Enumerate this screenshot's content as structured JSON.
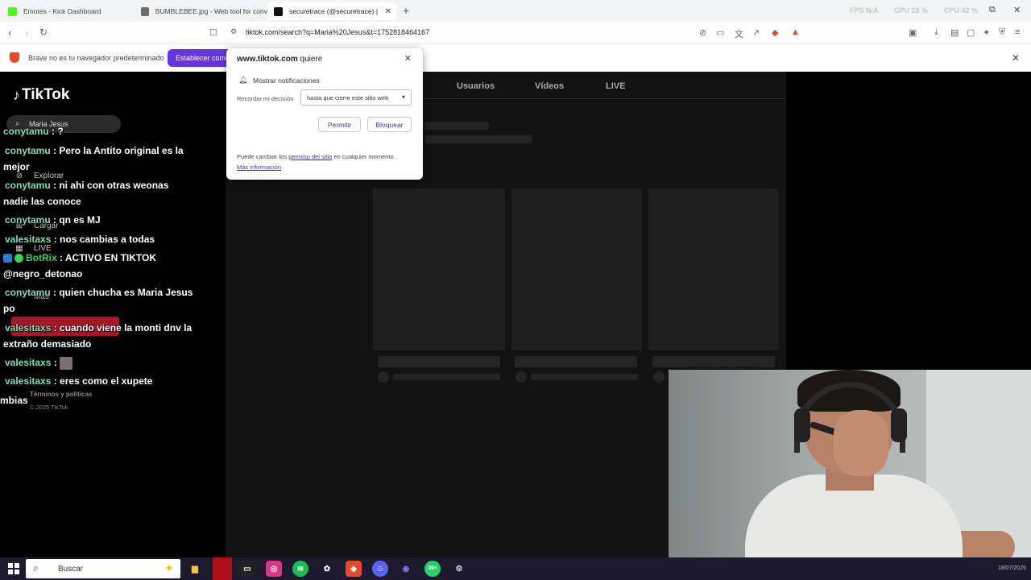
{
  "browser": {
    "tabs": [
      {
        "title": "Emotes - Kick Dashboard",
        "color": "#53fc18"
      },
      {
        "title": "BUMBLEBEE.jpg - Web tool for conv",
        "color": "#6b6b6b"
      },
      {
        "title": "securetrace (@securetrace) | TikT",
        "color": "#111111"
      }
    ],
    "close_glyph": "✕",
    "new_tab_glyph": "+",
    "sys_stats": [
      "FPS N/A",
      "CPU 28 %",
      "CPU 42 %"
    ],
    "window_controls": [
      "⎯",
      "⧉",
      "✕"
    ],
    "url": "tiktok.com/search?q=Maria%20Jesus&t=1752818464167",
    "nav_icons": [
      "chevron-left-icon",
      "chevron-right-icon",
      "reload-icon"
    ],
    "info_bar": {
      "message": "Brave no es tu navegador predeterminado",
      "button": "Establecer como"
    }
  },
  "tiktok": {
    "logo": "TikTok",
    "search_value": "Maria Jesus",
    "tabs": [
      "Usuarios",
      "Vídeos",
      "LIVE"
    ],
    "sidebar": [
      {
        "label": "Explorar",
        "icon": "⊘"
      },
      {
        "label": "Cargar",
        "icon": "⊞"
      },
      {
        "label": "LIVE",
        "icon": "▦"
      },
      {
        "label": "Más",
        "icon": "⋯"
      }
    ],
    "footer": {
      "terms": "Términos y políticas",
      "copyright": "© 2025 TikTok"
    }
  },
  "popup": {
    "site": "www.tiktok.com",
    "wants": " quiere",
    "permission": "Mostrar notificaciones",
    "remember_label": "Recordar mi decisión",
    "remember_value": "hasta que cierre este sitio web",
    "allow": "Permitir",
    "block": "Bloquear",
    "footer_pre": "Puede cambiar los ",
    "footer_link": "permiso del sitio",
    "footer_post": " en cualquier momento.",
    "more_info": "Más información"
  },
  "chat": [
    {
      "user": "conytamu",
      "text": " : ?"
    },
    {
      "user": "conytamu",
      "text": " : Pero la Antito original es la mejor"
    },
    {
      "user": "conytamu",
      "text": " : ni ahi con otras weonas nadie las conoce"
    },
    {
      "user": "conytamu",
      "text": " : qn es MJ"
    },
    {
      "user": "valesitaxs",
      "text": " : nos cambias a todas"
    },
    {
      "user": "BotRix",
      "text": " : ACTIVO EN TIKTOK @negro_detonao"
    },
    {
      "user": "conytamu",
      "text": " : quien chucha es Maria Jesus po"
    },
    {
      "user": "valesitaxs",
      "text": " : cuando viene la monti dnv la extraño demasiado"
    },
    {
      "user": "valesitaxs",
      "text": " : "
    },
    {
      "user": "valesitaxs",
      "text": " : eres como el xupete"
    },
    {
      "user": "",
      "text": "mbias"
    }
  ],
  "taskbar": {
    "search_placeholder": "Buscar",
    "badge": "99+",
    "clock": "18/07/2025"
  }
}
